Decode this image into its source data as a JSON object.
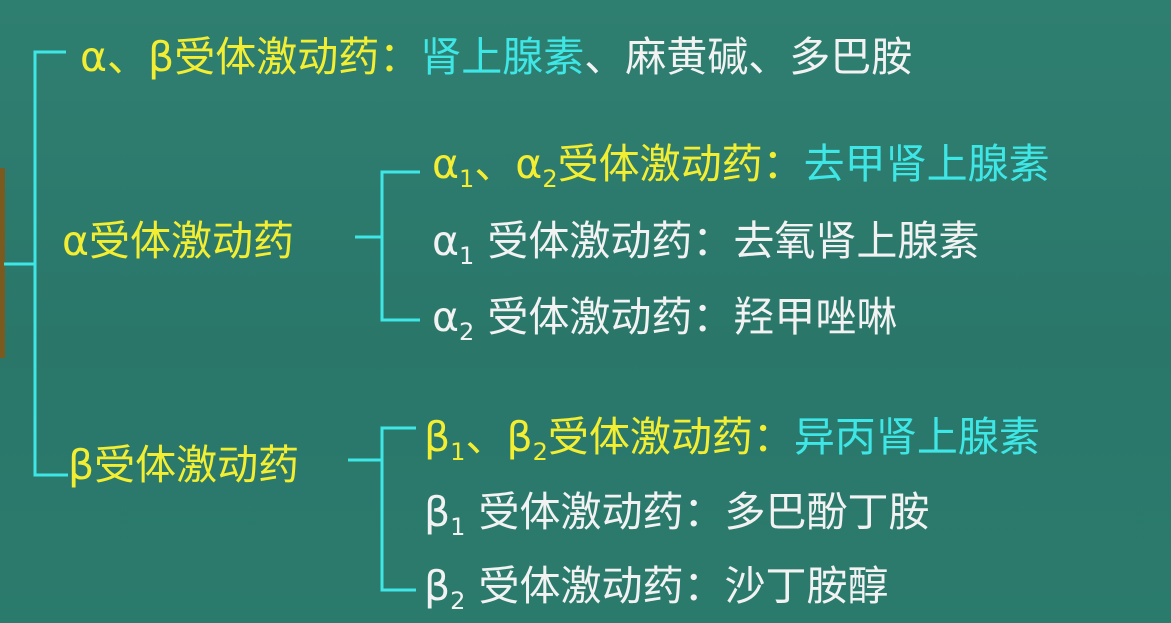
{
  "top": {
    "heading": "α、β受体激动药：",
    "primary_drug": "肾上腺素",
    "other_drugs": "、麻黄碱、多巴胺"
  },
  "alpha": {
    "heading": "α受体激动药",
    "items": [
      {
        "g": "α",
        "s1": "1",
        "mid": "、α",
        "s2": "2",
        "label": "受体激动药：",
        "drug": "去甲肾上腺素"
      },
      {
        "g": "α",
        "s1": "1",
        "label": " 受体激动药：",
        "drug": "去氧肾上腺素"
      },
      {
        "g": "α",
        "s1": "2",
        "label": " 受体激动药：",
        "drug": "羟甲唑啉"
      }
    ]
  },
  "beta": {
    "heading": "β受体激动药",
    "items": [
      {
        "g": "β",
        "s1": "1",
        "mid": "、β",
        "s2": "2",
        "label": "受体激动药：",
        "drug": "异丙肾上腺素"
      },
      {
        "g": "β",
        "s1": "1",
        "label": " 受体激动药：",
        "drug": "多巴酚丁胺"
      },
      {
        "g": "β",
        "s1": "2",
        "label": " 受体激动药：",
        "drug": "沙丁胺醇"
      }
    ]
  },
  "colors": {
    "background": "#2c7a6c",
    "heading": "#f4ee33",
    "highlight": "#3fe6e6",
    "text": "#f2f2f2",
    "lines": "#3fe6e6"
  }
}
